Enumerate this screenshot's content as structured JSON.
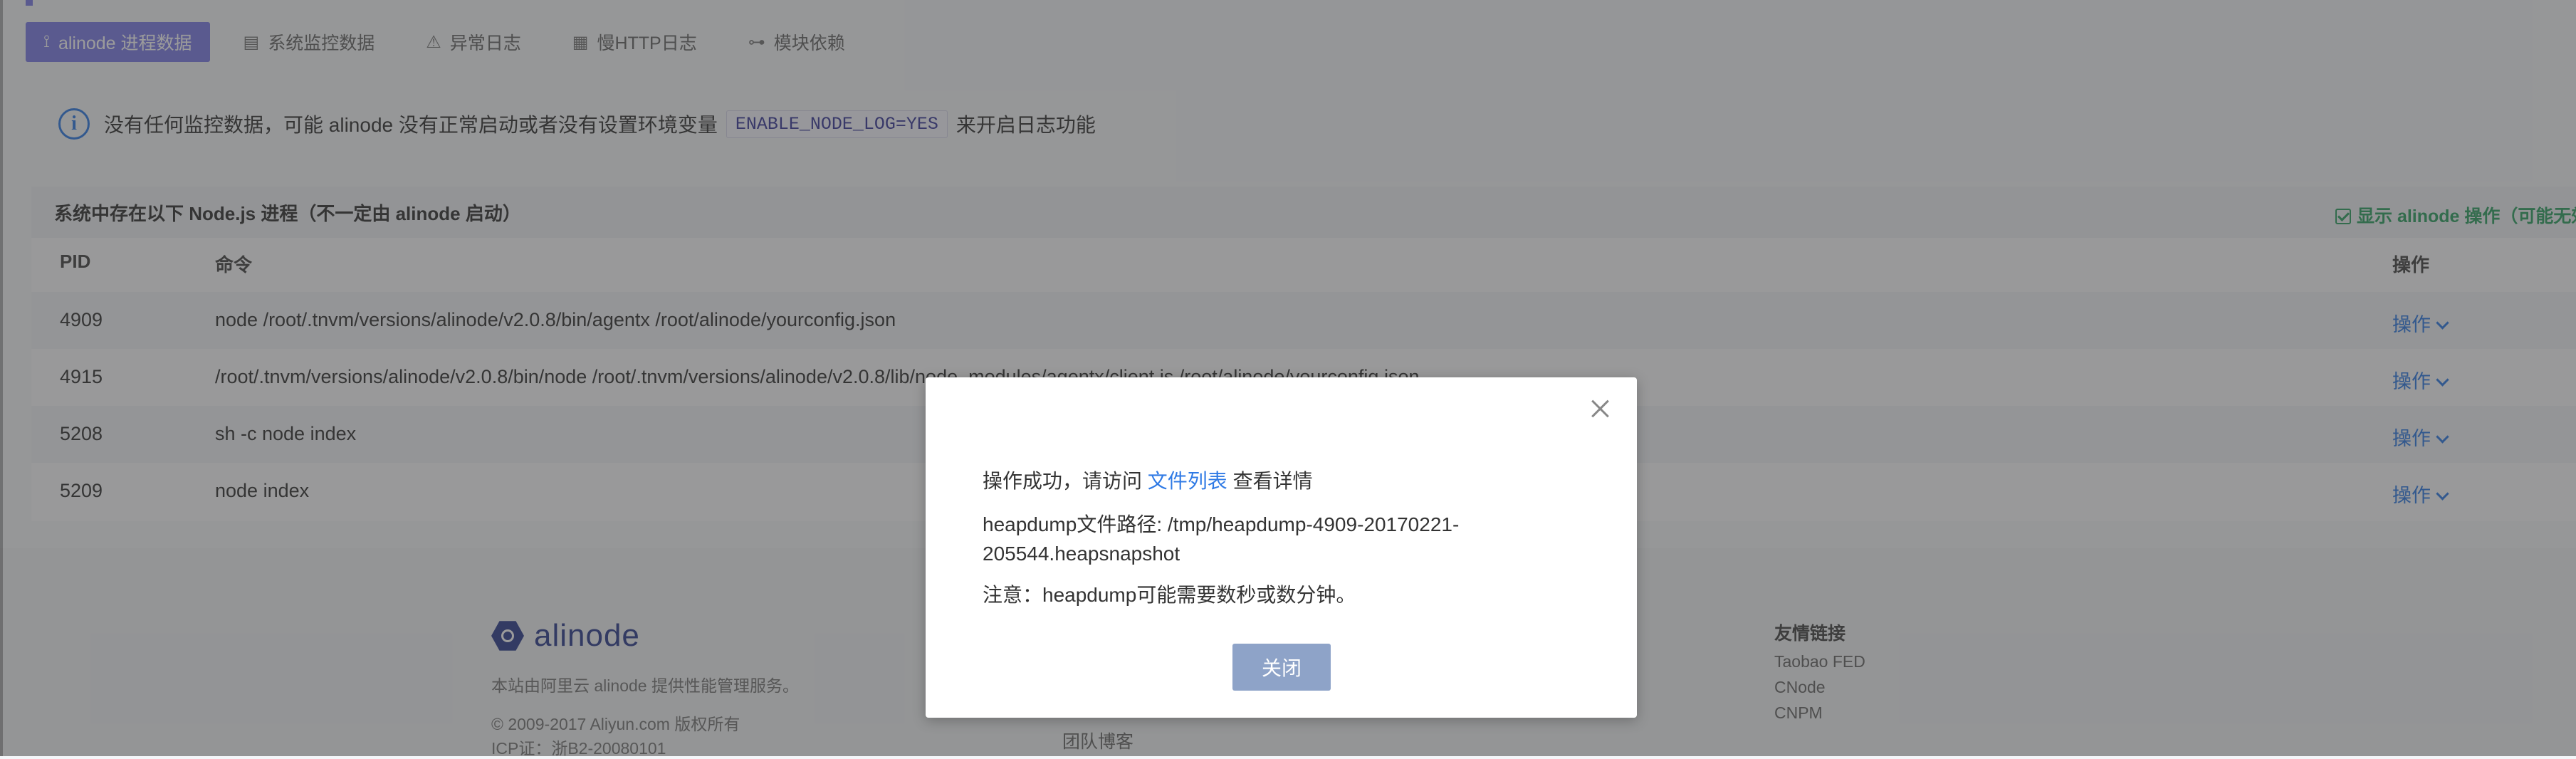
{
  "tabs": [
    {
      "label": "alinode 进程数据",
      "icon": "pulse-icon",
      "active": true
    },
    {
      "label": "系统监控数据",
      "icon": "list-icon",
      "active": false
    },
    {
      "label": "异常日志",
      "icon": "warning-icon",
      "active": false
    },
    {
      "label": "慢HTTP日志",
      "icon": "document-icon",
      "active": false
    },
    {
      "label": "模块依赖",
      "icon": "tree-icon",
      "active": false
    }
  ],
  "alert": {
    "text_before": "没有任何监控数据，可能 alinode 没有正常启动或者没有设置环境变量",
    "code": "ENABLE_NODE_LOG=YES",
    "text_after": "来开启日志功能"
  },
  "process_panel": {
    "title": "系统中存在以下 Node.js 进程（不一定由 alinode 启动）",
    "show_ops_label": "显示 alinode 操作（可能无效）",
    "columns": {
      "pid": "PID",
      "command": "命令",
      "action": "操作"
    },
    "rows": [
      {
        "pid": "4909",
        "command": "node /root/.tnvm/versions/alinode/v2.0.8/bin/agentx /root/alinode/yourconfig.json",
        "action": "操作"
      },
      {
        "pid": "4915",
        "command": "/root/.tnvm/versions/alinode/v2.0.8/bin/node /root/.tnvm/versions/alinode/v2.0.8/lib/node_modules/agentx/client.js /root/alinode/yourconfig.json",
        "action": "操作"
      },
      {
        "pid": "5208",
        "command": "sh -c node index",
        "action": "操作"
      },
      {
        "pid": "5209",
        "command": "node index",
        "action": "操作"
      }
    ]
  },
  "footer": {
    "brand": "alinode",
    "description": "本站由阿里云 alinode 提供性能管理服务。",
    "copyright": "© 2009-2017 Aliyun.com 版权所有",
    "icp": "ICP证：浙B2-20080101",
    "blog": "团队博客",
    "links_title": "友情链接",
    "links": [
      "Taobao FED",
      "CNode",
      "CNPM"
    ]
  },
  "modal": {
    "success_prefix": "操作成功，请访问",
    "file_list_link": "文件列表",
    "success_suffix": "查看详情",
    "path_text": "heapdump文件路径: /tmp/heapdump-4909-20170221-205544.heapsnapshot",
    "notice": "注意：heapdump可能需要数秒或数分钟。",
    "close_label": "关闭"
  },
  "colors": {
    "accent": "#7d7de6",
    "link": "#2f7ae5",
    "success": "#2fa062",
    "button": "#8ea3c8"
  }
}
